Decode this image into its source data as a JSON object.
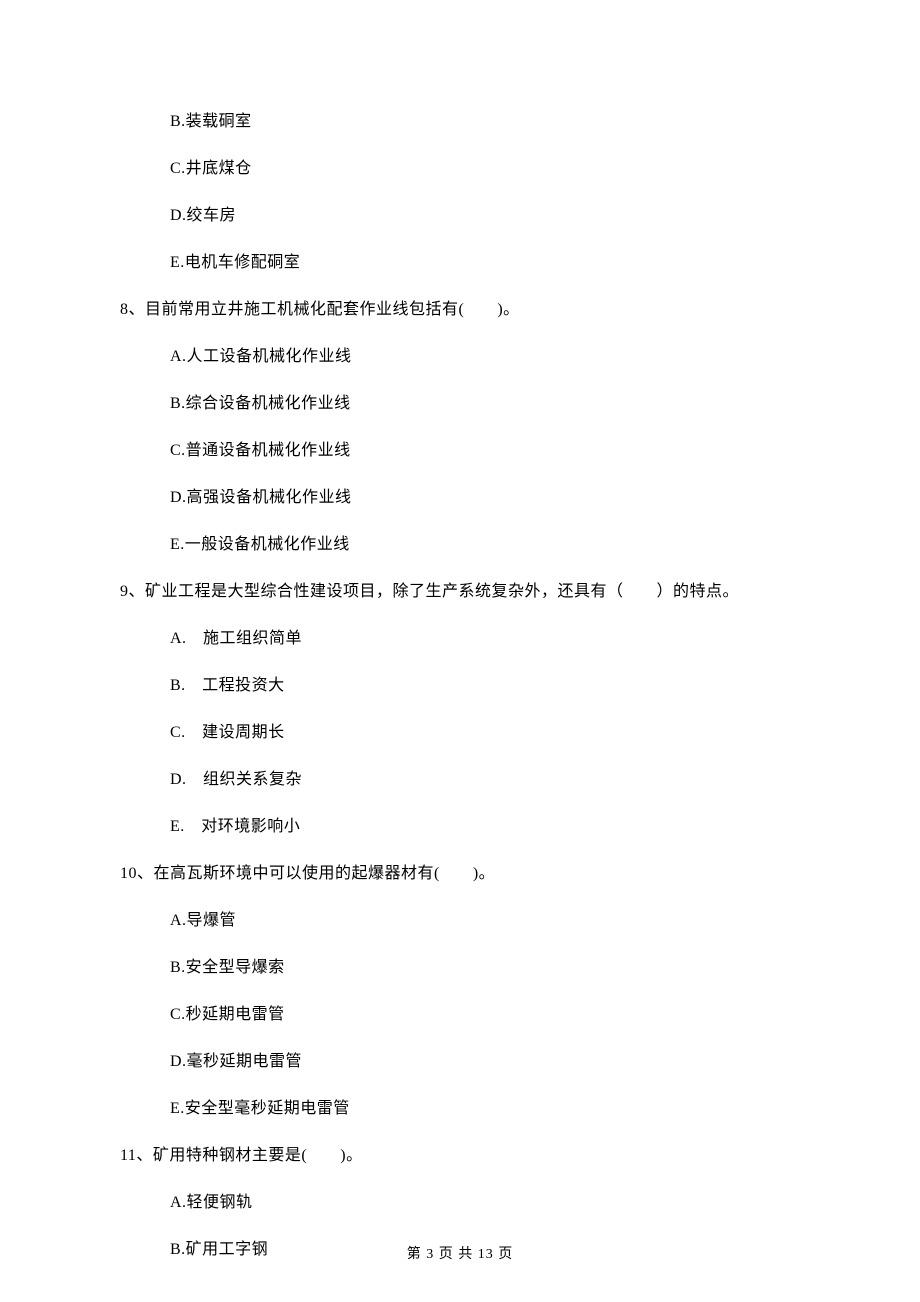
{
  "options_prev": {
    "b": "B.装载硐室",
    "c": "C.井底煤仓",
    "d": "D.绞车房",
    "e": "E.电机车修配硐室"
  },
  "q8": {
    "stem": "8、目前常用立井施工机械化配套作业线包括有(　　)。",
    "a": "A.人工设备机械化作业线",
    "b": "B.综合设备机械化作业线",
    "c": "C.普通设备机械化作业线",
    "d": "D.高强设备机械化作业线",
    "e": "E.一般设备机械化作业线"
  },
  "q9": {
    "stem": "9、矿业工程是大型综合性建设项目，除了生产系统复杂外，还具有（　　）的特点。",
    "a": "A.　施工组织简单",
    "b": "B.　工程投资大",
    "c": "C.　建设周期长",
    "d": "D.　组织关系复杂",
    "e": "E.　对环境影响小"
  },
  "q10": {
    "stem": "10、在高瓦斯环境中可以使用的起爆器材有(　　)。",
    "a": "A.导爆管",
    "b": "B.安全型导爆索",
    "c": "C.秒延期电雷管",
    "d": "D.毫秒延期电雷管",
    "e": "E.安全型毫秒延期电雷管"
  },
  "q11": {
    "stem": "11、矿用特种钢材主要是(　　)。",
    "a": "A.轻便钢轨",
    "b": "B.矿用工字钢"
  },
  "footer": "第 3 页 共 13 页"
}
